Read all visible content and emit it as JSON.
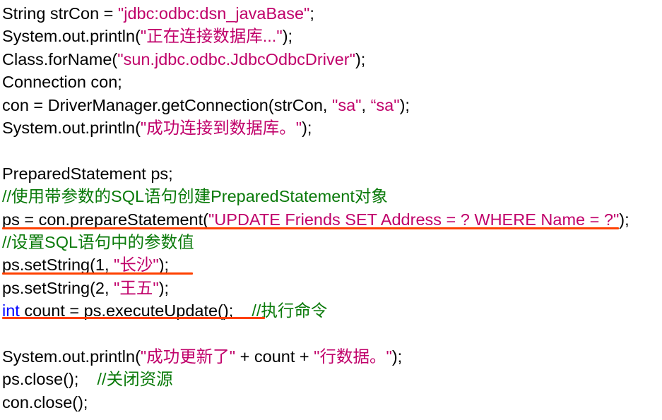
{
  "code": {
    "lines": [
      {
        "segments": [
          {
            "t": "String strCon = ",
            "c": "plain"
          },
          {
            "t": "\"jdbc:odbc:dsn_javaBase\"",
            "c": "str"
          },
          {
            "t": ";",
            "c": "plain"
          }
        ]
      },
      {
        "segments": [
          {
            "t": "System.out.println(",
            "c": "plain"
          },
          {
            "t": "\"正在连接数据库...\"",
            "c": "str"
          },
          {
            "t": ");",
            "c": "plain"
          }
        ]
      },
      {
        "segments": [
          {
            "t": "Class.forName(",
            "c": "plain"
          },
          {
            "t": "\"sun.jdbc.odbc.JdbcOdbcDriver\"",
            "c": "str"
          },
          {
            "t": ");",
            "c": "plain"
          }
        ]
      },
      {
        "segments": [
          {
            "t": "Connection con;",
            "c": "plain"
          }
        ]
      },
      {
        "segments": [
          {
            "t": "con = DriverManager.getConnection(strCon, ",
            "c": "plain"
          },
          {
            "t": "\"sa\"",
            "c": "str"
          },
          {
            "t": ", ",
            "c": "plain"
          },
          {
            "t": "“sa\"",
            "c": "str"
          },
          {
            "t": ");",
            "c": "plain"
          }
        ]
      },
      {
        "segments": [
          {
            "t": "System.out.println(",
            "c": "plain"
          },
          {
            "t": "\"成功连接到数据库。\"",
            "c": "str"
          },
          {
            "t": ");",
            "c": "plain"
          }
        ]
      },
      {
        "segments": []
      },
      {
        "segments": [
          {
            "t": "PreparedStatement ps;",
            "c": "plain"
          }
        ]
      },
      {
        "segments": [
          {
            "t": "//使用带参数的SQL语句创建PreparedStatement对象",
            "c": "cmt"
          }
        ]
      },
      {
        "segments": [
          {
            "t": "ps = con.prepareStatement(",
            "c": "plain"
          },
          {
            "t": "\"UPDATE Friends SET Address = ? WHERE Name = ?\"",
            "c": "str"
          },
          {
            "t": ");",
            "c": "plain"
          }
        ]
      },
      {
        "segments": [
          {
            "t": "//设置SQL语句中的参数值",
            "c": "cmt"
          }
        ]
      },
      {
        "segments": [
          {
            "t": "ps.setString(1, ",
            "c": "plain"
          },
          {
            "t": "\"长沙\"",
            "c": "str"
          },
          {
            "t": ");",
            "c": "plain"
          }
        ]
      },
      {
        "segments": [
          {
            "t": "ps.setString(2, ",
            "c": "plain"
          },
          {
            "t": "\"王五\"",
            "c": "str"
          },
          {
            "t": ");",
            "c": "plain"
          }
        ]
      },
      {
        "segments": [
          {
            "t": "int",
            "c": "kw"
          },
          {
            "t": " count = ps.executeUpdate();    ",
            "c": "plain"
          },
          {
            "t": "//执行命令",
            "c": "cmt"
          }
        ]
      },
      {
        "segments": []
      },
      {
        "segments": [
          {
            "t": "System.out.println(",
            "c": "plain"
          },
          {
            "t": "\"成功更新了\"",
            "c": "str"
          },
          {
            "t": " + count + ",
            "c": "plain"
          },
          {
            "t": "\"行数据。\"",
            "c": "str"
          },
          {
            "t": ");",
            "c": "plain"
          }
        ]
      },
      {
        "segments": [
          {
            "t": "ps.close();    ",
            "c": "plain"
          },
          {
            "t": "//关闭资源",
            "c": "cmt"
          }
        ]
      },
      {
        "segments": [
          {
            "t": "con.close();",
            "c": "plain"
          }
        ]
      }
    ]
  },
  "colors": {
    "text": "#000000",
    "string": "#c0006a",
    "comment": "#0a7a0a",
    "keyword": "#0000ff",
    "underline": "#ff4000"
  }
}
